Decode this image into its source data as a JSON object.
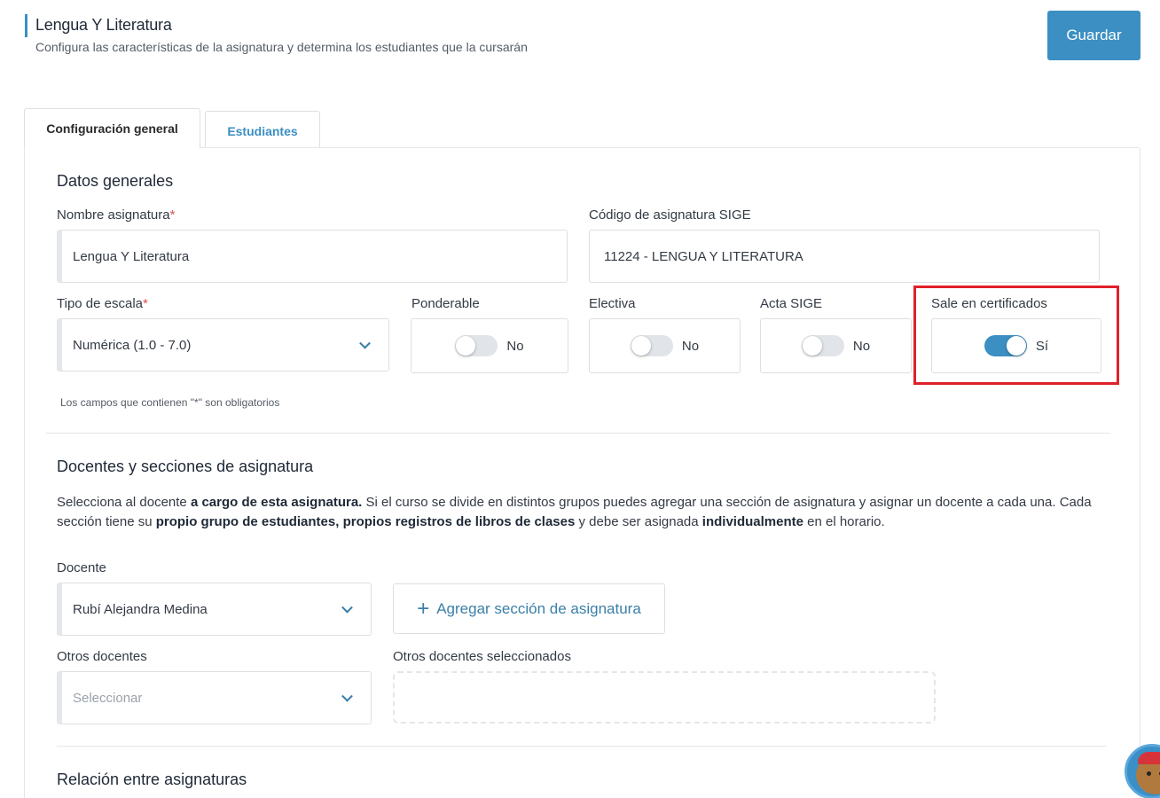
{
  "header": {
    "title": "Lengua Y Literatura",
    "subtitle": "Configura las características de la asignatura y determina los estudiantes que la cursarán",
    "save_label": "Guardar"
  },
  "tabs": [
    {
      "label": "Configuración general",
      "active": true
    },
    {
      "label": "Estudiantes",
      "active": false
    }
  ],
  "general": {
    "section_title": "Datos generales",
    "name_label": "Nombre asignatura",
    "name_value": "Lengua Y Literatura",
    "code_label": "Código de asignatura SIGE",
    "code_value": "11224 - LENGUA Y LITERATURA",
    "scale_label": "Tipo de escala",
    "scale_value": "Numérica (1.0 - 7.0)",
    "required_mark": "*",
    "ponderable_label": "Ponderable",
    "ponderable_value": "No",
    "electiva_label": "Electiva",
    "electiva_value": "No",
    "acta_label": "Acta SIGE",
    "acta_value": "No",
    "certificados_label": "Sale en certificados",
    "certificados_value": "Sí",
    "required_note": "Los campos que contienen \"*\" son obligatorios"
  },
  "teachers": {
    "section_title": "Docentes y secciones de asignatura",
    "desc_1": "Selecciona al docente ",
    "desc_b1": "a cargo de esta asignatura.",
    "desc_2": " Si el curso se divide en distintos grupos puedes agregar una sección de asignatura y asignar un docente a cada una. Cada sección tiene su ",
    "desc_b2": "propio grupo de estudiantes, propios registros de libros de clases",
    "desc_3": " y debe ser asignada ",
    "desc_b3": "individualmente",
    "desc_4": " en el horario.",
    "teacher_label": "Docente",
    "teacher_value": "Rubí Alejandra Medina",
    "add_section_label": "Agregar sección de asignatura",
    "other_label": "Otros docentes",
    "other_placeholder": "Seleccionar",
    "selected_label": "Otros docentes seleccionados"
  },
  "relations": {
    "section_title": "Relación entre asignaturas"
  },
  "colors": {
    "accent": "#3b8fc2",
    "highlight": "#e0202a",
    "required": "#d9534f"
  }
}
